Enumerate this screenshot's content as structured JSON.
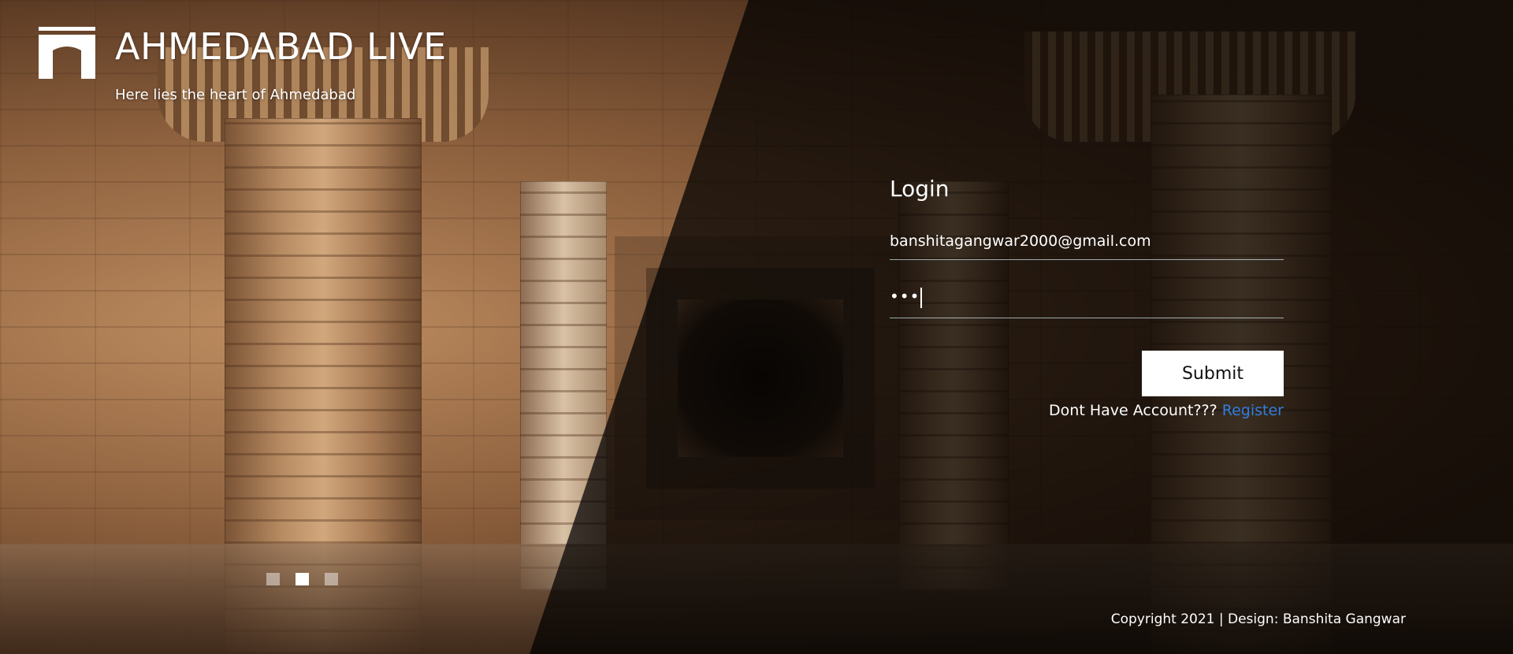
{
  "brand": {
    "logo_icon": "stepwell-gate-icon",
    "title": "AHMEDABAD LIVE",
    "tagline": "Here lies the heart of Ahmedabad"
  },
  "slider": {
    "dots": [
      "slide-1",
      "slide-2",
      "slide-3"
    ],
    "active_index": 1
  },
  "login": {
    "title": "Login",
    "email_value": "banshitagangwar2000@gmail.com",
    "password_mask": "•••",
    "submit_label": "Submit",
    "no_account_text": "Dont Have Account???",
    "register_label": "Register"
  },
  "footer": {
    "copyright": "Copyright 2021 | Design: Banshita Gangwar"
  },
  "colors": {
    "link": "#2f7fe0",
    "button_bg": "#ffffff",
    "text": "#ffffff"
  }
}
